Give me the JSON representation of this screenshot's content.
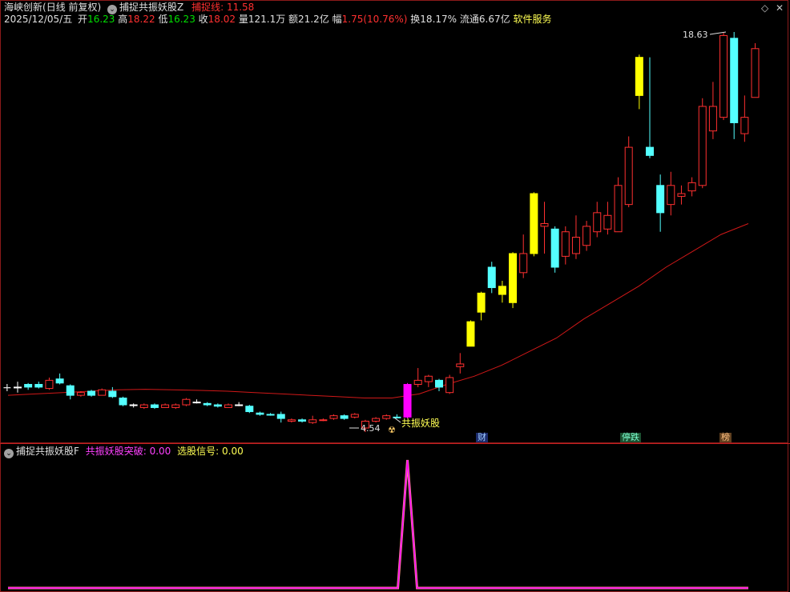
{
  "main": {
    "stock_name": "海峡创新",
    "period": "(日线 前复权)",
    "indicator_name": "捕捉共振妖股Z",
    "indicator_line_label": "捕捉线: 11.58",
    "date": "2025/12/05/五",
    "open_label": "开",
    "open_value": "16.23",
    "high_label": "高",
    "high_value": "18.22",
    "low_label": "低",
    "low_value": "16.23",
    "close_label": "收",
    "close_value": "18.02",
    "volume": "量121.1万",
    "amount": "额21.2亿",
    "change_label": "幅",
    "change_value": "1.75(10.76%)",
    "turnover": "换18.17%",
    "float_shares": "流通6.67亿",
    "service": "软件服务",
    "max_price_label": "18.63",
    "min_price_label": "4.54",
    "signal_label": "共振妖股",
    "tags": {
      "finance": "财",
      "limit_down": "停跌",
      "rank": "榜"
    }
  },
  "sub": {
    "indicator_name": "捕捉共振妖股F",
    "breakthrough_label": "共振妖股突破: 0.00",
    "signal_label": "选股信号: 0.00"
  },
  "colors": {
    "up": "#ff3030",
    "down": "#54ffff",
    "signal_candle": "#ffff00",
    "magenta": "#ff00ff",
    "ma": "#d01818",
    "yellow_text": "#ffff54",
    "green_text": "#00e000"
  },
  "chart_data": {
    "type": "candlestick",
    "price_range": [
      4.54,
      18.63
    ],
    "candles": [
      {
        "o": 5.6,
        "c": 5.6,
        "h": 5.8,
        "l": 5.4,
        "s": "flat"
      },
      {
        "o": 5.7,
        "c": 5.6,
        "h": 5.75,
        "l": 5.5,
        "s": "down"
      },
      {
        "o": 5.7,
        "c": 5.6,
        "h": 5.8,
        "l": 5.55,
        "s": "down"
      },
      {
        "o": 5.55,
        "c": 5.85,
        "h": 5.95,
        "l": 5.5,
        "s": "up"
      },
      {
        "o": 5.9,
        "c": 5.75,
        "h": 6.1,
        "l": 5.7,
        "s": "down"
      },
      {
        "o": 5.65,
        "c": 5.3,
        "h": 5.7,
        "l": 5.15,
        "s": "down"
      },
      {
        "o": 5.3,
        "c": 5.4,
        "h": 5.45,
        "l": 5.25,
        "s": "up"
      },
      {
        "o": 5.45,
        "c": 5.3,
        "h": 5.5,
        "l": 5.25,
        "s": "down"
      },
      {
        "o": 5.3,
        "c": 5.5,
        "h": 5.55,
        "l": 5.3,
        "s": "up"
      },
      {
        "o": 5.45,
        "c": 5.25,
        "h": 5.6,
        "l": 5.2,
        "s": "down"
      },
      {
        "o": 5.2,
        "c": 4.95,
        "h": 5.25,
        "l": 4.9,
        "s": "down"
      },
      {
        "o": 4.95,
        "c": 4.95,
        "h": 5.0,
        "l": 4.85,
        "s": "flat"
      },
      {
        "o": 4.85,
        "c": 4.95,
        "h": 5.0,
        "l": 4.8,
        "s": "up"
      },
      {
        "o": 4.95,
        "c": 4.85,
        "h": 5.0,
        "l": 4.8,
        "s": "down"
      },
      {
        "o": 4.85,
        "c": 4.95,
        "h": 5.0,
        "l": 4.85,
        "s": "up"
      },
      {
        "o": 4.85,
        "c": 4.95,
        "h": 5.0,
        "l": 4.8,
        "s": "up"
      },
      {
        "o": 4.95,
        "c": 5.15,
        "h": 5.2,
        "l": 4.9,
        "s": "up"
      },
      {
        "o": 5.05,
        "c": 5.05,
        "h": 5.15,
        "l": 5.0,
        "s": "flat"
      },
      {
        "o": 5.0,
        "c": 4.95,
        "h": 5.05,
        "l": 4.9,
        "s": "down"
      },
      {
        "o": 4.95,
        "c": 4.9,
        "h": 5.0,
        "l": 4.85,
        "s": "down"
      },
      {
        "o": 4.85,
        "c": 4.95,
        "h": 5.0,
        "l": 4.85,
        "s": "up"
      },
      {
        "o": 4.95,
        "c": 4.95,
        "h": 5.05,
        "l": 4.9,
        "s": "flat"
      },
      {
        "o": 4.9,
        "c": 4.7,
        "h": 4.95,
        "l": 4.65,
        "s": "down"
      },
      {
        "o": 4.65,
        "c": 4.6,
        "h": 4.7,
        "l": 4.55,
        "s": "down"
      },
      {
        "o": 4.6,
        "c": 4.6,
        "h": 4.65,
        "l": 4.55,
        "s": "down"
      },
      {
        "o": 4.6,
        "c": 4.45,
        "h": 4.7,
        "l": 4.3,
        "s": "down"
      },
      {
        "o": 4.35,
        "c": 4.4,
        "h": 4.45,
        "l": 4.3,
        "s": "up"
      },
      {
        "o": 4.4,
        "c": 4.35,
        "h": 4.45,
        "l": 4.3,
        "s": "down"
      },
      {
        "o": 4.3,
        "c": 4.4,
        "h": 4.55,
        "l": 4.25,
        "s": "up"
      },
      {
        "o": 4.4,
        "c": 4.4,
        "h": 4.45,
        "l": 4.35,
        "s": "up"
      },
      {
        "o": 4.45,
        "c": 4.55,
        "h": 4.6,
        "l": 4.4,
        "s": "up"
      },
      {
        "o": 4.55,
        "c": 4.45,
        "h": 4.6,
        "l": 4.4,
        "s": "down"
      },
      {
        "o": 4.5,
        "c": 4.6,
        "h": 4.65,
        "l": 4.45,
        "s": "up"
      },
      {
        "o": 4.35,
        "c": 4.1,
        "h": 4.4,
        "l": 3.95,
        "s": "up"
      },
      {
        "o": 4.35,
        "c": 4.45,
        "h": 4.5,
        "l": 4.3,
        "s": "up"
      },
      {
        "o": 4.45,
        "c": 4.55,
        "h": 4.6,
        "l": 4.4,
        "s": "up"
      },
      {
        "o": 4.5,
        "c": 4.5,
        "h": 4.6,
        "l": 4.45,
        "s": "down"
      },
      {
        "o": 4.5,
        "c": 5.7,
        "h": 5.75,
        "l": 4.45,
        "s": "magenta"
      },
      {
        "o": 5.7,
        "c": 5.85,
        "h": 6.3,
        "l": 5.6,
        "s": "up"
      },
      {
        "o": 5.8,
        "c": 6.0,
        "h": 6.05,
        "l": 5.6,
        "s": "up"
      },
      {
        "o": 5.85,
        "c": 5.6,
        "h": 5.9,
        "l": 5.45,
        "s": "down"
      },
      {
        "o": 5.4,
        "c": 5.95,
        "h": 6.05,
        "l": 5.35,
        "s": "up"
      },
      {
        "o": 6.35,
        "c": 6.45,
        "h": 6.85,
        "l": 6.1,
        "s": "up"
      },
      {
        "o": 7.1,
        "c": 8.0,
        "h": 8.05,
        "l": 7.1,
        "s": "yellow"
      },
      {
        "o": 8.35,
        "c": 9.05,
        "h": 9.1,
        "l": 8.05,
        "s": "yellow"
      },
      {
        "o": 10.0,
        "c": 9.25,
        "h": 10.2,
        "l": 9.05,
        "s": "down"
      },
      {
        "o": 9.3,
        "c": 9.0,
        "h": 9.5,
        "l": 8.7,
        "s": "yellow"
      },
      {
        "o": 8.7,
        "c": 10.5,
        "h": 10.55,
        "l": 8.5,
        "s": "yellow"
      },
      {
        "o": 9.8,
        "c": 10.5,
        "h": 11.2,
        "l": 9.6,
        "s": "up"
      },
      {
        "o": 10.5,
        "c": 12.7,
        "h": 12.75,
        "l": 10.4,
        "s": "yellow"
      },
      {
        "o": 11.5,
        "c": 11.6,
        "h": 12.4,
        "l": 10.5,
        "s": "up"
      },
      {
        "o": 11.4,
        "c": 10.0,
        "h": 11.5,
        "l": 9.8,
        "s": "down"
      },
      {
        "o": 10.4,
        "c": 11.3,
        "h": 11.5,
        "l": 10.1,
        "s": "up"
      },
      {
        "o": 10.5,
        "c": 11.1,
        "h": 11.9,
        "l": 10.3,
        "s": "up"
      },
      {
        "o": 10.8,
        "c": 11.5,
        "h": 11.7,
        "l": 10.6,
        "s": "up"
      },
      {
        "o": 11.3,
        "c": 12.0,
        "h": 12.4,
        "l": 11.1,
        "s": "up"
      },
      {
        "o": 11.4,
        "c": 11.9,
        "h": 12.4,
        "l": 11.2,
        "s": "up"
      },
      {
        "o": 11.3,
        "c": 13.0,
        "h": 13.3,
        "l": 11.3,
        "s": "up"
      },
      {
        "o": 12.3,
        "c": 14.4,
        "h": 14.8,
        "l": 12.2,
        "s": "up"
      },
      {
        "o": 17.7,
        "c": 16.3,
        "h": 17.8,
        "l": 15.8,
        "s": "yellow"
      },
      {
        "o": 14.4,
        "c": 14.1,
        "h": 17.7,
        "l": 14.0,
        "s": "down"
      },
      {
        "o": 13.0,
        "c": 12.0,
        "h": 13.4,
        "l": 11.3,
        "s": "down"
      },
      {
        "o": 12.3,
        "c": 13.0,
        "h": 13.5,
        "l": 11.9,
        "s": "up"
      },
      {
        "o": 12.6,
        "c": 12.7,
        "h": 13.0,
        "l": 12.3,
        "s": "up"
      },
      {
        "o": 12.8,
        "c": 13.1,
        "h": 13.3,
        "l": 12.6,
        "s": "up"
      },
      {
        "o": 13.0,
        "c": 15.9,
        "h": 16.2,
        "l": 12.9,
        "s": "up"
      },
      {
        "o": 15.0,
        "c": 15.9,
        "h": 16.8,
        "l": 14.7,
        "s": "up"
      },
      {
        "o": 15.5,
        "c": 18.5,
        "h": 18.6,
        "l": 15.4,
        "s": "up"
      },
      {
        "o": 18.4,
        "c": 15.3,
        "h": 18.63,
        "l": 14.7,
        "s": "down"
      },
      {
        "o": 14.9,
        "c": 15.5,
        "h": 16.3,
        "l": 14.6,
        "s": "up"
      },
      {
        "o": 16.23,
        "c": 18.02,
        "h": 18.22,
        "l": 16.23,
        "s": "up"
      }
    ],
    "ma_line": [
      5.3,
      5.35,
      5.4,
      5.45,
      5.5,
      5.52,
      5.5,
      5.48,
      5.45,
      5.4,
      5.35,
      5.3,
      5.25,
      5.2,
      5.2,
      5.35,
      5.7,
      6.0,
      6.4,
      6.9,
      7.4,
      8.1,
      8.7,
      9.3,
      10.0,
      10.6,
      11.2,
      11.6
    ],
    "sub_series": {
      "peak_index": 37,
      "peak_value": 1,
      "baseline": 0
    }
  }
}
